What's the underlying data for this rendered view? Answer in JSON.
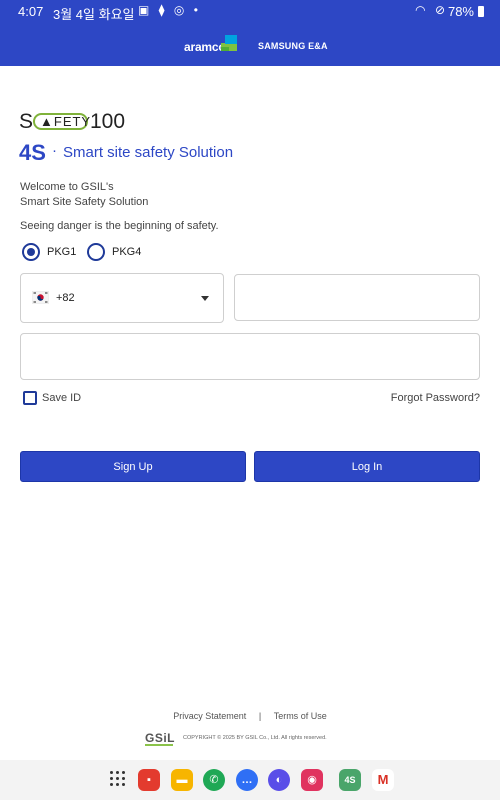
{
  "status": {
    "time": "4:07",
    "date": "3월 4일 화요일",
    "battery": "78%"
  },
  "brands": {
    "aramco": "aramco",
    "samsung": "SAMSUNG E&A"
  },
  "logo": {
    "s": "S",
    "pill": "FETY",
    "num": "100",
    "tag_4s": "4S",
    "tag_dot": "·",
    "tag_text": "Smart site safety Solution"
  },
  "welcome": {
    "line1": "Welcome to GSIL's",
    "line2": "Smart Site Safety Solution",
    "motto": "Seeing danger is the beginning of safety."
  },
  "packages": [
    {
      "label": "PKG1",
      "checked": true
    },
    {
      "label": "PKG4",
      "checked": false
    }
  ],
  "form": {
    "country_code": "+82",
    "phone_value": "",
    "password_value": "",
    "save_id_label": "Save ID",
    "save_id_checked": false,
    "forgot_label": "Forgot Password?",
    "signup_label": "Sign Up",
    "login_label": "Log In"
  },
  "footer": {
    "privacy": "Privacy Statement",
    "separator": "|",
    "terms": "Terms of Use",
    "gsil": "GSiL",
    "copyright": "COPYRIGHT © 2025 BY GSIL Co., Ltd. All rights reserved."
  },
  "dock": {
    "foursafety_badge": "4S"
  },
  "colors": {
    "primary": "#2d47c5",
    "accent_green": "#7fb23a"
  }
}
